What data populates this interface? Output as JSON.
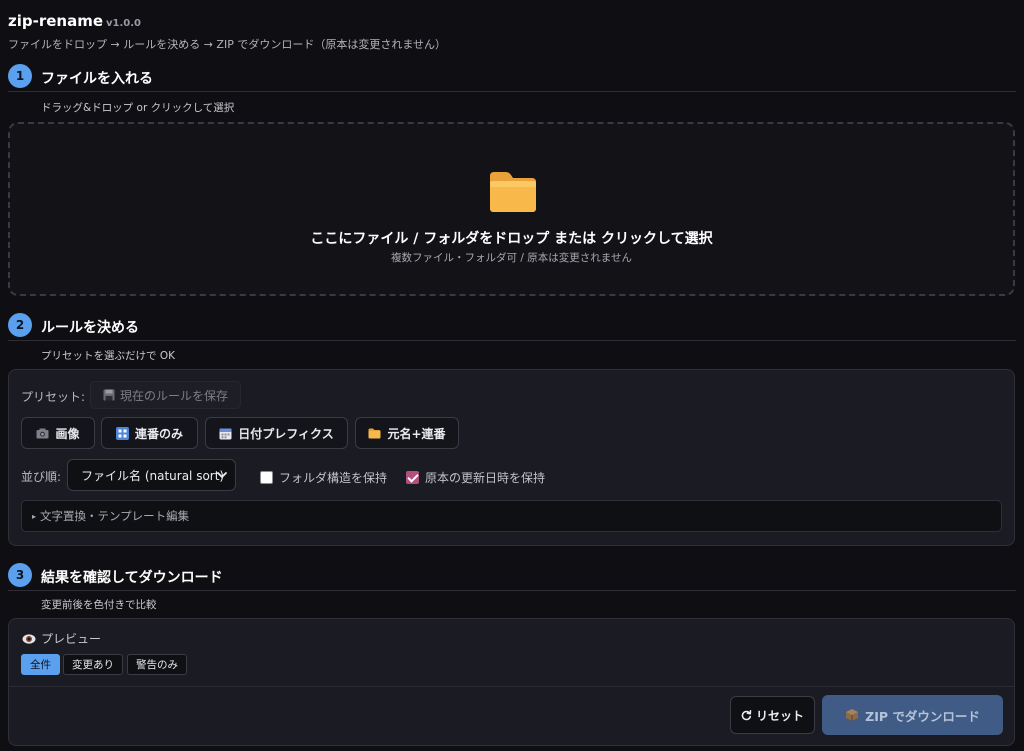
{
  "app": {
    "name": "zip-rename",
    "version": "v1.0.0",
    "subtitle": "ファイルをドロップ → ルールを決める → ZIP でダウンロード（原本は変更されません）"
  },
  "step1": {
    "number": "1",
    "title": "ファイルを入れる",
    "subtitle": "ドラッグ&ドロップ or クリックして選択",
    "drop_main": "ここにファイル / フォルダをドロップ または クリックして選択",
    "drop_sub": "複数ファイル・フォルダ可 / 原本は変更されません"
  },
  "step2": {
    "number": "2",
    "title": "ルールを決める",
    "subtitle": "プリセットを選ぶだけで OK",
    "preset_label": "プリセット:",
    "save_label": "現在のルールを保存",
    "presets": [
      {
        "label": "画像",
        "icon": "photo-icon"
      },
      {
        "label": "連番のみ",
        "icon": "numbers-icon"
      },
      {
        "label": "日付プレフィクス",
        "icon": "calendar-icon"
      },
      {
        "label": "元名+連番",
        "icon": "folder-icon"
      }
    ],
    "sort_label": "並び順:",
    "sort_value": "ファイル名 (natural sort)",
    "keep_folder_label": "フォルダ構造を保持",
    "keep_folder_checked": false,
    "keep_mtime_label": "原本の更新日時を保持",
    "keep_mtime_checked": true,
    "details_label": "文字置換・テンプレート編集"
  },
  "step3": {
    "number": "3",
    "title": "結果を確認してダウンロード",
    "subtitle": "変更前後を色付きで比較",
    "preview_label": "プレビュー",
    "filters": [
      "全件",
      "変更あり",
      "警告のみ"
    ],
    "active_filter": "全件",
    "reset_label": "リセット",
    "download_label": "ZIP でダウンロード"
  },
  "colors": {
    "background": "#0f0f13",
    "panel": "#1b1c23",
    "accent": "#5aa0ee",
    "checkbox_checked": "#b14f7f",
    "download_button": "#3f5b86",
    "folder": "#f9b84a"
  }
}
